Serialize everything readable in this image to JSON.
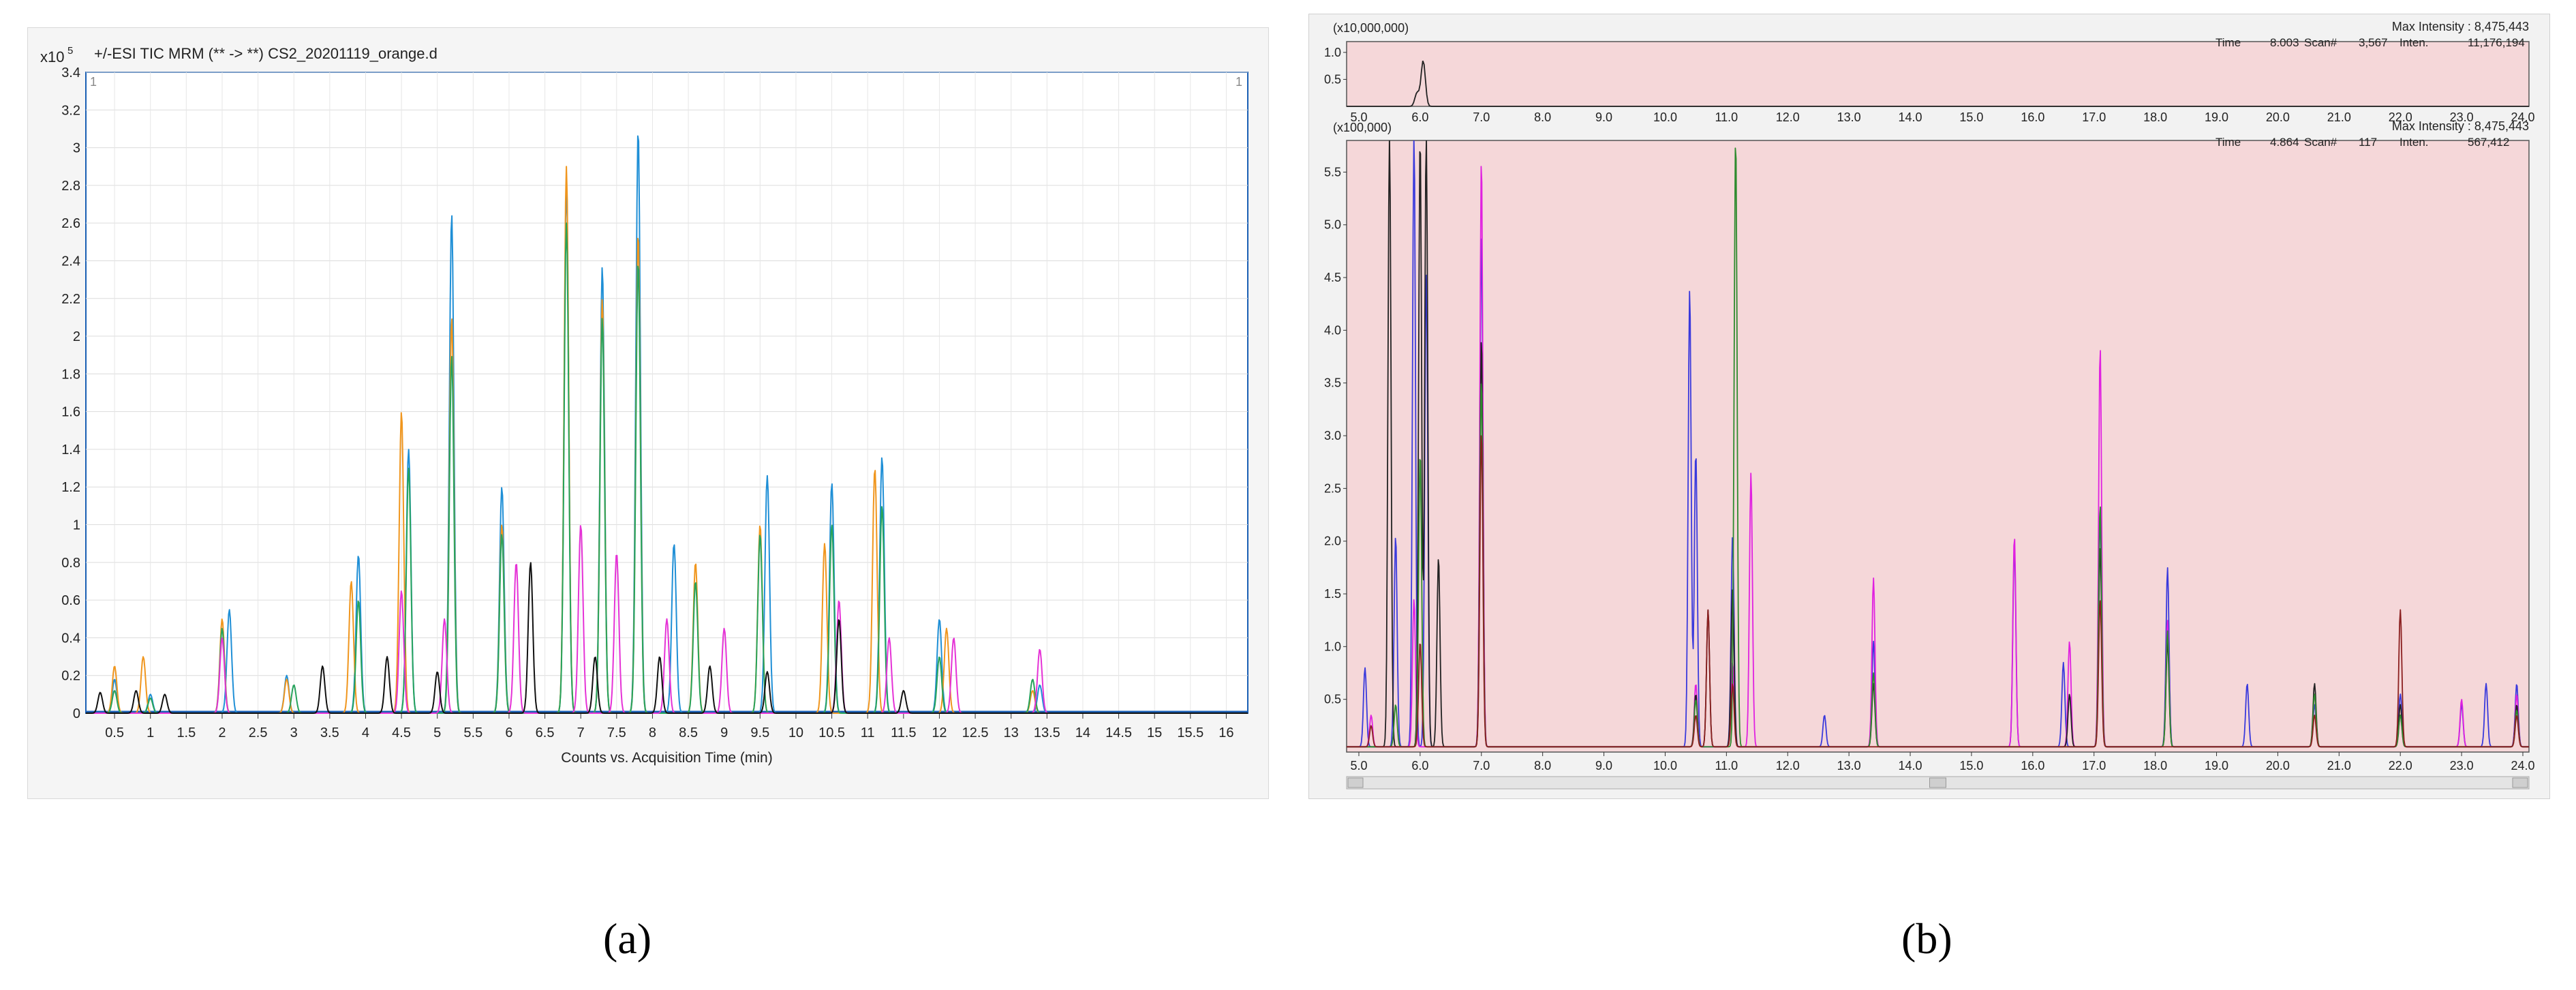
{
  "panel_labels": {
    "a": "(a)",
    "b": "(b)"
  },
  "chart_data": [
    {
      "id": "a",
      "type": "line",
      "title": "+/-ESI TIC MRM (** -> **) CS2_20201119_orange.d",
      "y_multiplier": "x10",
      "y_exponent": "5",
      "xlabel": "Counts vs. Acquisition Time (min)",
      "ylabel": "",
      "xlim": [
        0.1,
        16.3
      ],
      "ylim": [
        0,
        3.4
      ],
      "xticks": [
        "0.5",
        "1",
        "1.5",
        "2",
        "2.5",
        "3",
        "3.5",
        "4",
        "4.5",
        "5",
        "5.5",
        "6",
        "6.5",
        "7",
        "7.5",
        "8",
        "8.5",
        "9",
        "9.5",
        "10",
        "10.5",
        "11",
        "11.5",
        "12",
        "12.5",
        "13",
        "13.5",
        "14",
        "14.5",
        "15",
        "15.5",
        "16"
      ],
      "yticks": [
        "0",
        "0.2",
        "0.4",
        "0.6",
        "0.8",
        "1",
        "1.2",
        "1.4",
        "1.6",
        "1.8",
        "2",
        "2.2",
        "2.4",
        "2.6",
        "2.8",
        "3",
        "3.2",
        "3.4"
      ],
      "corner_marks": [
        "1",
        "1"
      ],
      "grid": true,
      "series": [
        {
          "color": "#1f8fd6",
          "peaks": [
            [
              0.5,
              0.18
            ],
            [
              1.0,
              0.1
            ],
            [
              2.1,
              0.55
            ],
            [
              2.9,
              0.2
            ],
            [
              3.9,
              0.84
            ],
            [
              4.6,
              1.4
            ],
            [
              5.2,
              2.65
            ],
            [
              5.9,
              1.2
            ],
            [
              6.8,
              2.8
            ],
            [
              7.3,
              2.37
            ],
            [
              7.8,
              3.1
            ],
            [
              8.3,
              0.9
            ],
            [
              9.6,
              1.26
            ],
            [
              10.5,
              1.22
            ],
            [
              11.2,
              1.36
            ],
            [
              12.0,
              0.5
            ],
            [
              13.4,
              0.15
            ]
          ]
        },
        {
          "color": "#f0961e",
          "peaks": [
            [
              0.5,
              0.25
            ],
            [
              0.9,
              0.3
            ],
            [
              2.0,
              0.5
            ],
            [
              2.9,
              0.18
            ],
            [
              3.8,
              0.7
            ],
            [
              4.5,
              1.6
            ],
            [
              5.2,
              2.1
            ],
            [
              5.9,
              1.0
            ],
            [
              6.8,
              2.9
            ],
            [
              7.3,
              2.2
            ],
            [
              7.8,
              2.55
            ],
            [
              8.6,
              0.8
            ],
            [
              9.5,
              1.0
            ],
            [
              10.4,
              0.9
            ],
            [
              11.1,
              1.3
            ],
            [
              12.1,
              0.45
            ],
            [
              13.3,
              0.12
            ]
          ]
        },
        {
          "color": "#27a35c",
          "peaks": [
            [
              0.5,
              0.12
            ],
            [
              1.0,
              0.08
            ],
            [
              2.0,
              0.45
            ],
            [
              3.0,
              0.15
            ],
            [
              3.9,
              0.6
            ],
            [
              4.6,
              1.3
            ],
            [
              5.2,
              1.9
            ],
            [
              5.9,
              0.95
            ],
            [
              6.8,
              2.6
            ],
            [
              7.3,
              2.1
            ],
            [
              7.8,
              2.4
            ],
            [
              8.6,
              0.7
            ],
            [
              9.5,
              0.95
            ],
            [
              10.5,
              1.0
            ],
            [
              11.2,
              1.1
            ],
            [
              12.0,
              0.3
            ],
            [
              13.3,
              0.18
            ]
          ]
        },
        {
          "color": "#e533d6",
          "peaks": [
            [
              2.0,
              0.4
            ],
            [
              4.5,
              0.65
            ],
            [
              5.1,
              0.5
            ],
            [
              6.1,
              0.8
            ],
            [
              7.0,
              1.0
            ],
            [
              7.5,
              0.85
            ],
            [
              8.2,
              0.5
            ],
            [
              9.0,
              0.45
            ],
            [
              10.6,
              0.6
            ],
            [
              11.3,
              0.4
            ],
            [
              12.2,
              0.4
            ],
            [
              13.4,
              0.34
            ]
          ]
        },
        {
          "color": "#111111",
          "peaks": [
            [
              0.3,
              0.11
            ],
            [
              0.8,
              0.12
            ],
            [
              1.2,
              0.1
            ],
            [
              3.4,
              0.25
            ],
            [
              4.3,
              0.3
            ],
            [
              5.0,
              0.22
            ],
            [
              6.3,
              0.8
            ],
            [
              7.2,
              0.3
            ],
            [
              8.1,
              0.3
            ],
            [
              8.8,
              0.25
            ],
            [
              9.6,
              0.22
            ],
            [
              10.6,
              0.5
            ],
            [
              11.5,
              0.12
            ]
          ]
        }
      ]
    },
    {
      "id": "b",
      "type": "line",
      "top_strip": {
        "scale_label": "(x10,000,000)",
        "max_intensity_label": "Max Intensity : 8,475,443",
        "readout": {
          "time_label": "Time",
          "time": "8.003",
          "scan_label": "Scan#",
          "scan": "3,567",
          "inten_label": "Inten.",
          "inten": "11,176,194"
        },
        "yticks": [
          "0.5",
          "1.0"
        ],
        "ylim": [
          0,
          1.2
        ]
      },
      "main": {
        "scale_label": "(x100,000)",
        "max_intensity_label": "Max Intensity : 8,475,443",
        "readout": {
          "time_label": "Time",
          "time": "4.864",
          "scan_label": "Scan#",
          "scan": "117",
          "inten_label": "Inten.",
          "inten": "567,412"
        },
        "yticks": [
          "0.5",
          "1.0",
          "1.5",
          "2.0",
          "2.5",
          "3.0",
          "3.5",
          "4.0",
          "4.5",
          "5.0",
          "5.5"
        ],
        "ylim": [
          0,
          5.8
        ]
      },
      "xlim": [
        4.8,
        24.1
      ],
      "xticks": [
        "5.0",
        "6.0",
        "7.0",
        "8.0",
        "9.0",
        "10.0",
        "11.0",
        "12.0",
        "13.0",
        "14.0",
        "15.0",
        "16.0",
        "17.0",
        "18.0",
        "19.0",
        "20.0",
        "21.0",
        "22.0",
        "23.0",
        "24.0"
      ],
      "background_color": "#f5d7d9",
      "series": [
        {
          "color": "#3a3adc",
          "peaks": [
            [
              5.1,
              0.75
            ],
            [
              5.6,
              2.0
            ],
            [
              5.9,
              5.8
            ],
            [
              6.1,
              4.5
            ],
            [
              7.0,
              4.9
            ],
            [
              10.4,
              4.35
            ],
            [
              10.5,
              2.8
            ],
            [
              11.1,
              2.0
            ],
            [
              12.6,
              0.3
            ],
            [
              13.4,
              1.0
            ],
            [
              15.7,
              1.9
            ],
            [
              16.5,
              0.8
            ],
            [
              17.1,
              2.2
            ],
            [
              18.2,
              1.7
            ],
            [
              19.5,
              0.6
            ],
            [
              20.6,
              0.4
            ],
            [
              22.0,
              0.5
            ],
            [
              23.0,
              0.4
            ],
            [
              23.4,
              0.6
            ],
            [
              23.9,
              0.6
            ]
          ]
        },
        {
          "color": "#e021e0",
          "peaks": [
            [
              5.2,
              0.3
            ],
            [
              5.9,
              1.4
            ],
            [
              7.0,
              5.6
            ],
            [
              10.5,
              0.6
            ],
            [
              11.1,
              0.8
            ],
            [
              11.4,
              2.6
            ],
            [
              13.4,
              1.6
            ],
            [
              15.7,
              2.0
            ],
            [
              16.6,
              1.0
            ],
            [
              17.1,
              3.8
            ],
            [
              18.2,
              1.2
            ],
            [
              20.6,
              0.5
            ],
            [
              22.0,
              0.3
            ],
            [
              23.0,
              0.45
            ],
            [
              23.9,
              0.5
            ]
          ]
        },
        {
          "color": "#222222",
          "peaks": [
            [
              5.5,
              5.8
            ],
            [
              6.0,
              5.8
            ],
            [
              6.1,
              5.8
            ],
            [
              6.3,
              1.8
            ],
            [
              7.0,
              3.9
            ],
            [
              10.5,
              0.5
            ],
            [
              10.7,
              1.3
            ],
            [
              11.1,
              1.5
            ],
            [
              13.4,
              0.6
            ],
            [
              16.6,
              0.5
            ],
            [
              17.1,
              1.9
            ],
            [
              18.2,
              1.0
            ],
            [
              20.6,
              0.6
            ],
            [
              22.0,
              0.4
            ],
            [
              23.9,
              0.4
            ]
          ]
        },
        {
          "color": "#2e8b2e",
          "peaks": [
            [
              5.6,
              0.4
            ],
            [
              6.0,
              2.8
            ],
            [
              7.0,
              3.5
            ],
            [
              10.5,
              0.45
            ],
            [
              11.15,
              5.8
            ],
            [
              13.4,
              0.7
            ],
            [
              17.1,
              2.3
            ],
            [
              18.2,
              1.1
            ],
            [
              20.6,
              0.5
            ],
            [
              22.0,
              0.3
            ],
            [
              23.9,
              0.35
            ]
          ]
        },
        {
          "color": "#8b2020",
          "peaks": [
            [
              5.2,
              0.2
            ],
            [
              6.0,
              1.0
            ],
            [
              7.0,
              3.0
            ],
            [
              10.5,
              0.3
            ],
            [
              10.7,
              1.3
            ],
            [
              11.1,
              0.6
            ],
            [
              17.1,
              1.4
            ],
            [
              20.6,
              0.3
            ],
            [
              22.0,
              1.3
            ],
            [
              23.9,
              0.3
            ]
          ]
        }
      ]
    }
  ]
}
